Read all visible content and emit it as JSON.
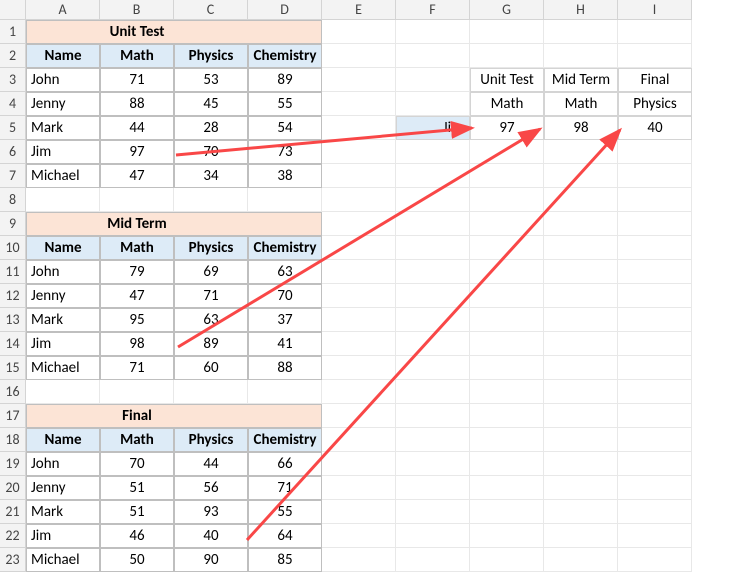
{
  "columns": [
    "A",
    "B",
    "C",
    "D",
    "E",
    "F",
    "G",
    "H",
    "I"
  ],
  "rowCount": 23,
  "table1": {
    "title": "Unit Test",
    "headers": [
      "Name",
      "Math",
      "Physics",
      "Chemistry"
    ],
    "rows": [
      {
        "name": "John",
        "math": "71",
        "physics": "53",
        "chem": "89"
      },
      {
        "name": "Jenny",
        "math": "88",
        "physics": "45",
        "chem": "55"
      },
      {
        "name": "Mark",
        "math": "44",
        "physics": "28",
        "chem": "54"
      },
      {
        "name": "Jim",
        "math": "97",
        "physics": "70",
        "chem": "73"
      },
      {
        "name": "Michael",
        "math": "47",
        "physics": "34",
        "chem": "38"
      }
    ]
  },
  "table2": {
    "title": "Mid Term",
    "headers": [
      "Name",
      "Math",
      "Physics",
      "Chemistry"
    ],
    "rows": [
      {
        "name": "John",
        "math": "79",
        "physics": "69",
        "chem": "63"
      },
      {
        "name": "Jenny",
        "math": "47",
        "physics": "71",
        "chem": "70"
      },
      {
        "name": "Mark",
        "math": "95",
        "physics": "63",
        "chem": "37"
      },
      {
        "name": "Jim",
        "math": "98",
        "physics": "89",
        "chem": "41"
      },
      {
        "name": "Michael",
        "math": "71",
        "physics": "60",
        "chem": "88"
      }
    ]
  },
  "table3": {
    "title": "Final",
    "headers": [
      "Name",
      "Math",
      "Physics",
      "Chemistry"
    ],
    "rows": [
      {
        "name": "John",
        "math": "70",
        "physics": "44",
        "chem": "66"
      },
      {
        "name": "Jenny",
        "math": "51",
        "physics": "56",
        "chem": "71"
      },
      {
        "name": "Mark",
        "math": "51",
        "physics": "93",
        "chem": "55"
      },
      {
        "name": "Jim",
        "math": "46",
        "physics": "40",
        "chem": "64"
      },
      {
        "name": "Michael",
        "math": "50",
        "physics": "90",
        "chem": "85"
      }
    ]
  },
  "summary": {
    "hdr1": [
      "Unit Test",
      "Mid Term",
      "Final"
    ],
    "hdr2": [
      "Math",
      "Math",
      "Physics"
    ],
    "name": "Jim",
    "vals": [
      "97",
      "98",
      "40"
    ]
  }
}
